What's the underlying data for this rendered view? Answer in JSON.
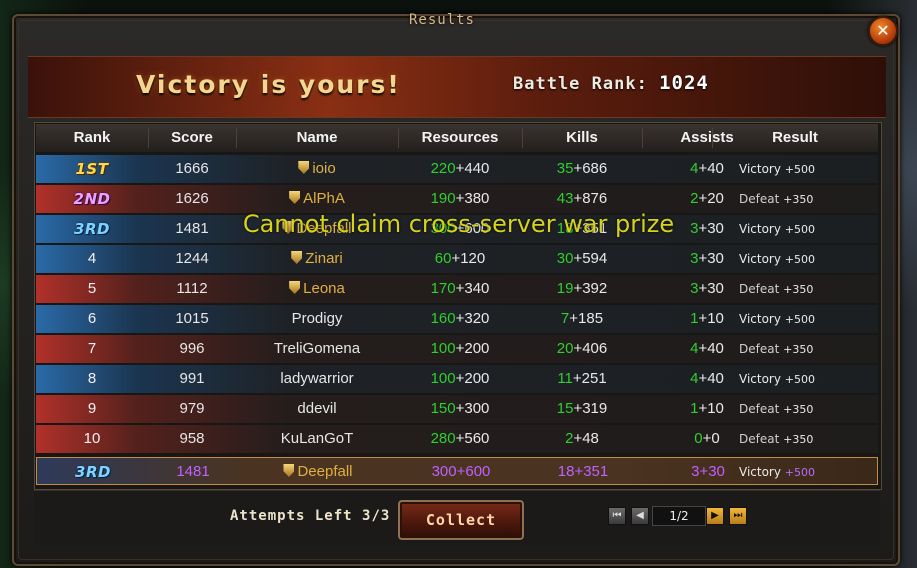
{
  "window": {
    "title": "Results"
  },
  "banner": {
    "headline": "Victory is yours!",
    "battle_rank_label": "Battle Rank:",
    "battle_rank_value": "1024"
  },
  "table": {
    "headers": [
      "Rank",
      "Score",
      "Name",
      "Resources",
      "Kills",
      "Assists",
      "Result"
    ],
    "rows": [
      {
        "rank": "1ST",
        "score": "1666",
        "name": "ioio",
        "res_base": "220",
        "res_bonus": "+440",
        "kills_base": "35",
        "kills_bonus": "+686",
        "assists_base": "4",
        "assists_bonus": "+40",
        "result": "Victory",
        "result_bonus": "+500"
      },
      {
        "rank": "2ND",
        "score": "1626",
        "name": "AlPhA",
        "res_base": "190",
        "res_bonus": "+380",
        "kills_base": "43",
        "kills_bonus": "+876",
        "assists_base": "2",
        "assists_bonus": "+20",
        "result": "Defeat",
        "result_bonus": "+350"
      },
      {
        "rank": "3RD",
        "score": "1481",
        "name": "Deepfall",
        "res_base": "300",
        "res_bonus": "+600",
        "kills_base": "18",
        "kills_bonus": "+351",
        "assists_base": "3",
        "assists_bonus": "+30",
        "result": "Victory",
        "result_bonus": "+500"
      },
      {
        "rank": "4",
        "score": "1244",
        "name": "Zinari",
        "res_base": "60",
        "res_bonus": "+120",
        "kills_base": "30",
        "kills_bonus": "+594",
        "assists_base": "3",
        "assists_bonus": "+30",
        "result": "Victory",
        "result_bonus": "+500"
      },
      {
        "rank": "5",
        "score": "1112",
        "name": "Leona",
        "res_base": "170",
        "res_bonus": "+340",
        "kills_base": "19",
        "kills_bonus": "+392",
        "assists_base": "3",
        "assists_bonus": "+30",
        "result": "Defeat",
        "result_bonus": "+350"
      },
      {
        "rank": "6",
        "score": "1015",
        "name": "Prodigy",
        "res_base": "160",
        "res_bonus": "+320",
        "kills_base": "7",
        "kills_bonus": "+185",
        "assists_base": "1",
        "assists_bonus": "+10",
        "result": "Victory",
        "result_bonus": "+500"
      },
      {
        "rank": "7",
        "score": "996",
        "name": "TreliGomena",
        "res_base": "100",
        "res_bonus": "+200",
        "kills_base": "20",
        "kills_bonus": "+406",
        "assists_base": "4",
        "assists_bonus": "+40",
        "result": "Defeat",
        "result_bonus": "+350"
      },
      {
        "rank": "8",
        "score": "991",
        "name": "ladywarrior",
        "res_base": "100",
        "res_bonus": "+200",
        "kills_base": "11",
        "kills_bonus": "+251",
        "assists_base": "4",
        "assists_bonus": "+40",
        "result": "Victory",
        "result_bonus": "+500"
      },
      {
        "rank": "9",
        "score": "979",
        "name": "ddevil",
        "res_base": "150",
        "res_bonus": "+300",
        "kills_base": "15",
        "kills_bonus": "+319",
        "assists_base": "1",
        "assists_bonus": "+10",
        "result": "Defeat",
        "result_bonus": "+350"
      },
      {
        "rank": "10",
        "score": "958",
        "name": "KuLanGoT",
        "res_base": "280",
        "res_bonus": "+560",
        "kills_base": "2",
        "kills_bonus": "+48",
        "assists_base": "0",
        "assists_bonus": "+0",
        "result": "Defeat",
        "result_bonus": "+350"
      }
    ],
    "my_row": {
      "rank": "3RD",
      "score": "1481",
      "name": "Deepfall",
      "res_base": "300",
      "res_bonus": "+600",
      "kills_base": "18",
      "kills_bonus": "+351",
      "assists_base": "3",
      "assists_bonus": "+30",
      "result": "Victory",
      "result_bonus": "+500"
    }
  },
  "overlay_message": "Cannot claim cross-server war prize",
  "footer": {
    "attempts_label": "Attempts Left",
    "attempts_value": "3/3",
    "collect_label": "Collect",
    "page_indicator": "1/2"
  }
}
